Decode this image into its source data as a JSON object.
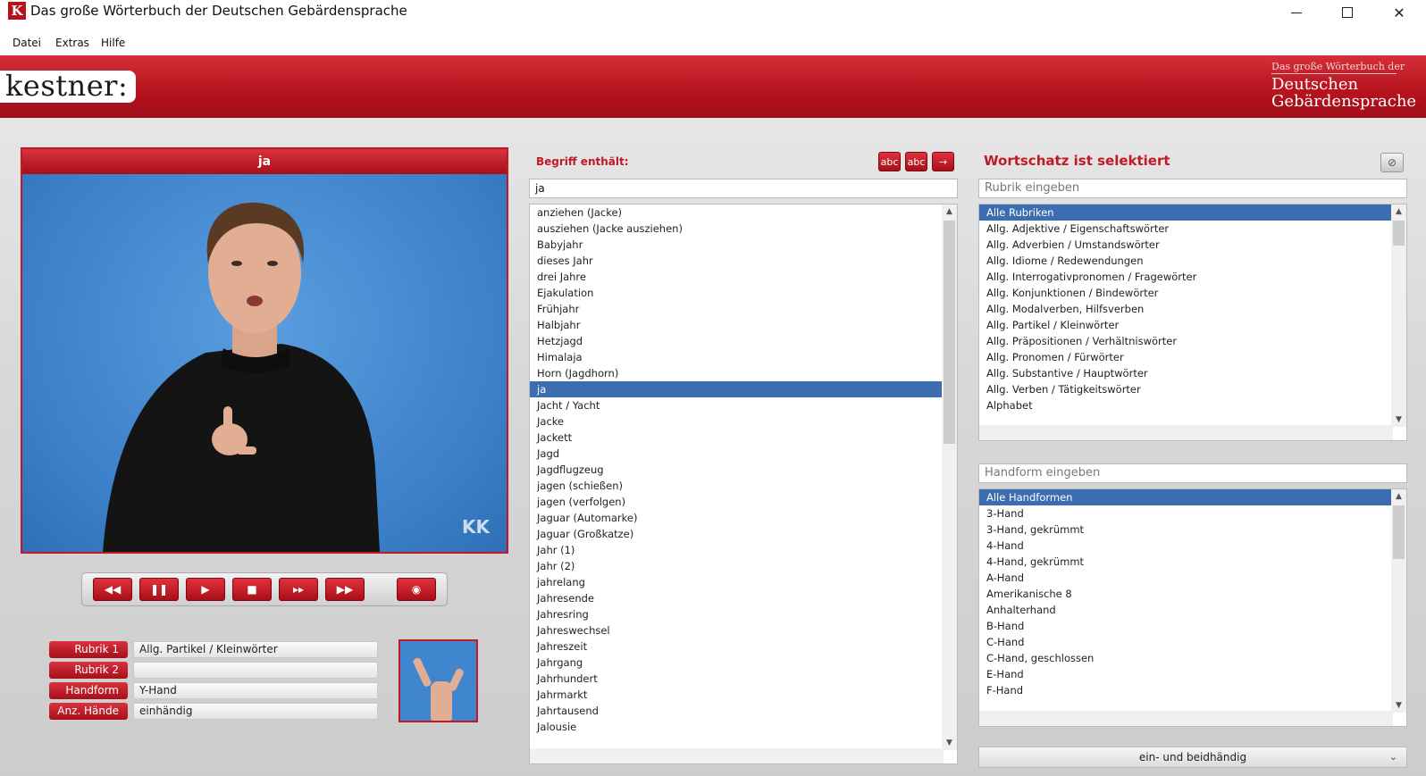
{
  "window": {
    "icon_letter": "K",
    "title": "Das große Wörterbuch der Deutschen Gebärdensprache"
  },
  "menu": [
    "Datei",
    "Extras",
    "Hilfe"
  ],
  "banner": {
    "logo": "kestner:",
    "subtitle_small": "Das große Wörterbuch der",
    "subtitle_line1": "Deutschen",
    "subtitle_line2": "Gebärdensprache"
  },
  "video": {
    "title": "ja",
    "watermark": "KK"
  },
  "controls": [
    "rewind",
    "pause",
    "play",
    "stop",
    "slow-forward",
    "fast-forward",
    "snapshot"
  ],
  "info": [
    {
      "label": "Rubrik 1",
      "value": "Allg. Partikel / Kleinwörter"
    },
    {
      "label": "Rubrik 2",
      "value": ""
    },
    {
      "label": "Handform",
      "value": "Y-Hand"
    },
    {
      "label": "Anz. Hände",
      "value": "einhändig"
    }
  ],
  "search": {
    "label": "Begriff enthält:",
    "value": "ja",
    "buttons": [
      "abc",
      "abc",
      "→"
    ]
  },
  "terms": {
    "selected_index": 11,
    "items": [
      "anziehen (Jacke)",
      "ausziehen (Jacke ausziehen)",
      "Babyjahr",
      "dieses Jahr",
      "drei Jahre",
      "Ejakulation",
      "Frühjahr",
      "Halbjahr",
      "Hetzjagd",
      "Himalaja",
      "Horn (Jagdhorn)",
      "ja",
      "Jacht / Yacht",
      "Jacke",
      "Jackett",
      "Jagd",
      "Jagdflugzeug",
      "jagen (schießen)",
      "jagen (verfolgen)",
      "Jaguar (Automarke)",
      "Jaguar (Großkatze)",
      "Jahr (1)",
      "Jahr (2)",
      "jahrelang",
      "Jahresende",
      "Jahresring",
      "Jahreswechsel",
      "Jahreszeit",
      "Jahrgang",
      "Jahrhundert",
      "Jahrmarkt",
      "Jahrtausend",
      "Jalousie"
    ]
  },
  "right": {
    "heading": "Wortschatz ist selektiert",
    "rubrik_placeholder": "Rubrik eingeben",
    "rubriken": {
      "selected_index": 0,
      "items": [
        "Alle Rubriken",
        "Allg. Adjektive / Eigenschaftswörter",
        "Allg. Adverbien / Umstandswörter",
        "Allg. Idiome / Redewendungen",
        "Allg. Interrogativpronomen / Fragewörter",
        "Allg. Konjunktionen / Bindewörter",
        "Allg. Modalverben, Hilfsverben",
        "Allg. Partikel / Kleinwörter",
        "Allg. Präpositionen / Verhältniswörter",
        "Allg. Pronomen / Fürwörter",
        "Allg. Substantive / Hauptwörter",
        "Allg. Verben / Tätigkeitswörter",
        "Alphabet"
      ]
    },
    "handform_placeholder": "Handform eingeben",
    "handformen": {
      "selected_index": 0,
      "items": [
        "Alle Handformen",
        "3-Hand",
        "3-Hand, gekrümmt",
        "4-Hand",
        "4-Hand, gekrümmt",
        "A-Hand",
        "Amerikanische 8",
        "Anhalterhand",
        "B-Hand",
        "C-Hand",
        "C-Hand, geschlossen",
        "E-Hand",
        "F-Hand"
      ]
    },
    "hands_dropdown": "ein- und beidhändig"
  }
}
